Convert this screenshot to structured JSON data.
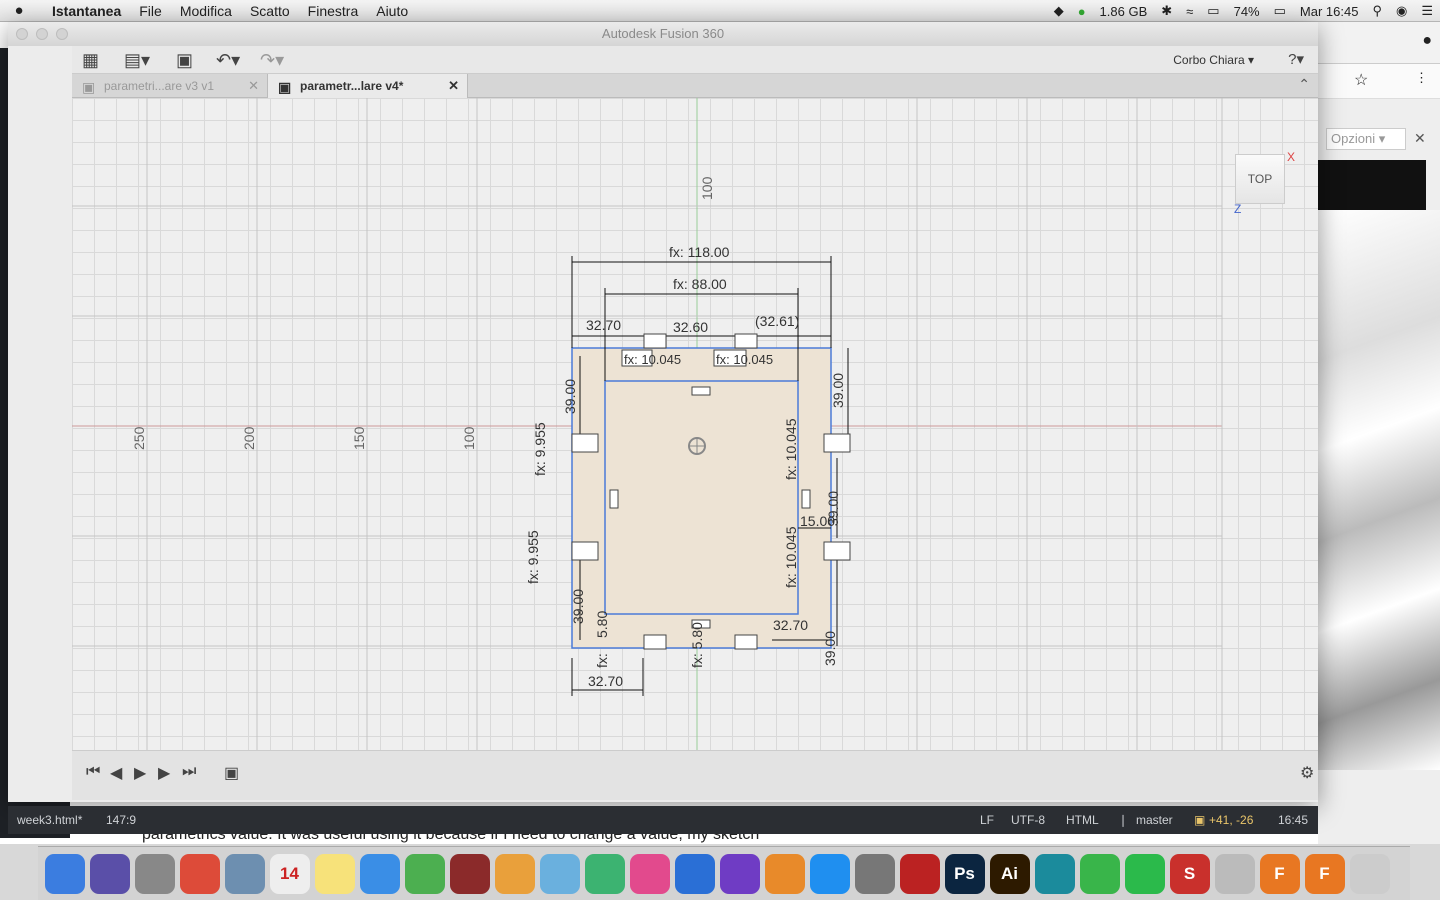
{
  "menubar": {
    "apple": "",
    "items": [
      "Istantanea",
      "File",
      "Modifica",
      "Scatto",
      "Finestra",
      "Aiuto"
    ],
    "status": {
      "memory": "1.86 GB",
      "battery": "74%",
      "clock": "Mar 16:45"
    }
  },
  "window": {
    "title": "Autodesk Fusion 360"
  },
  "toolbar": {
    "user": "Corbo Chiara ▾",
    "help": "?▾"
  },
  "tabs": [
    {
      "label": "parametri...are v3 v1",
      "state": "inactive"
    },
    {
      "label": "parametr...lare v4*",
      "state": "active"
    }
  ],
  "viewcube": {
    "face": "TOP",
    "axis_x": "X",
    "axis_z": "Z"
  },
  "ruler": {
    "x_labels": [
      "250",
      "200",
      "150",
      "100"
    ],
    "y_label": "100"
  },
  "dimensions": {
    "overall": "fx: 118.00",
    "inner": "fx: 88.00",
    "top_left": "32.70",
    "top_mid": "32.60",
    "top_right": "(32.61)",
    "slot_left": "fx: 10.045",
    "slot_right": "fx: 10.045",
    "left_top": "39.00",
    "left_fx1": "fx: 9.955",
    "left_fx2": "fx: 9.955",
    "left_bottom": "39.00",
    "right_top": "39.00",
    "right_fx1": "fx: 10.045",
    "right_fx2": "fx: 10.045",
    "right_mid": "39.00",
    "right_small": "15.00",
    "right_bottom": "39.00",
    "bottom_left": "32.70",
    "bottom_right": "32.70",
    "bottom_580": "5.80",
    "bottom_mid": "fx: 5.80",
    "bottom_fx": "fx:"
  },
  "statusbar": {
    "file": "week3.html*",
    "cursor": "147:9",
    "eol": "LF",
    "encoding": "UTF-8",
    "grammar": "HTML",
    "branch": "master",
    "diff": "+41, -26",
    "time": "16:45"
  },
  "subtext": "parametrics value. It was useful using it because if I need to change a value, my sketch",
  "browser": {
    "options": "Opzioni"
  },
  "dock": [
    "Finder",
    "Siri",
    "Launchpad",
    "Chrome",
    "Preview",
    "14",
    "Notes",
    "Messages",
    "FaceTime",
    "Photo Booth",
    "Photos",
    "Preview",
    "Numbers",
    "iTunes",
    "Keynote",
    "iMovie",
    "iBooks",
    "App Store",
    "Preferences",
    "FileZilla",
    "Ps",
    "Ai",
    "Arduino",
    "Atom",
    "WeChat",
    "S",
    "Scissors",
    "F",
    "F",
    "Trash"
  ]
}
